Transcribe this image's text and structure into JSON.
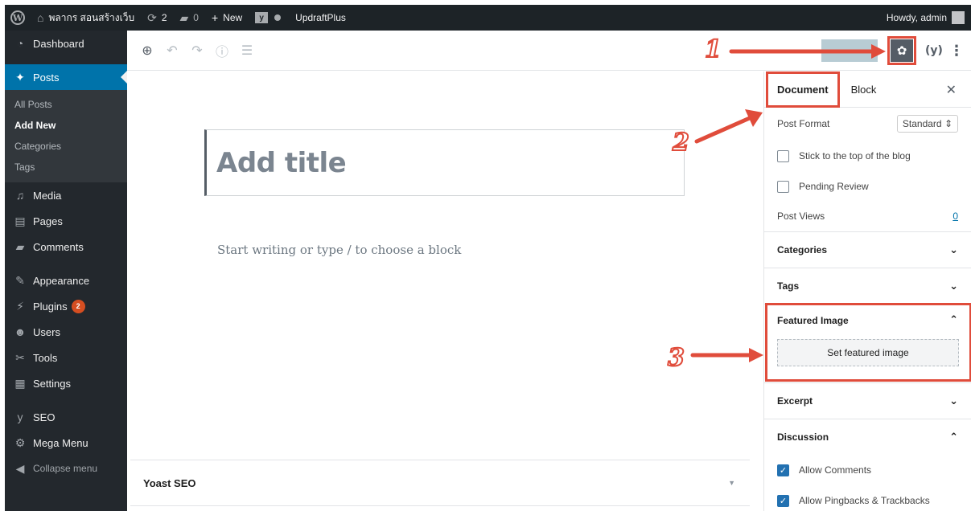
{
  "adminbar": {
    "site_name": "พลากร สอนสร้างเว็บ",
    "updates_count": "2",
    "comments_count": "0",
    "new_label": "New",
    "plugin_label": "UpdraftPlus",
    "greeting": "Howdy, admin"
  },
  "sidebar": {
    "items": [
      {
        "label": "Dashboard",
        "icon": "dashboard-icon"
      },
      {
        "label": "Posts",
        "icon": "pin-icon"
      },
      {
        "label": "Media",
        "icon": "media-icon"
      },
      {
        "label": "Pages",
        "icon": "pages-icon"
      },
      {
        "label": "Comments",
        "icon": "comment-icon"
      },
      {
        "label": "Appearance",
        "icon": "brush-icon"
      },
      {
        "label": "Plugins",
        "icon": "plugin-icon",
        "badge": "2"
      },
      {
        "label": "Users",
        "icon": "users-icon"
      },
      {
        "label": "Tools",
        "icon": "wrench-icon"
      },
      {
        "label": "Settings",
        "icon": "settings-icon"
      },
      {
        "label": "SEO",
        "icon": "yoast-icon"
      },
      {
        "label": "Mega Menu",
        "icon": "megamenu-icon"
      },
      {
        "label": "Collapse menu",
        "icon": "collapse-icon"
      }
    ],
    "posts_submenu": [
      "All Posts",
      "Add New",
      "Categories",
      "Tags"
    ]
  },
  "editor": {
    "title_placeholder": "Add title",
    "block_placeholder": "Start writing or type / to choose a block",
    "metabox_title": "Yoast SEO"
  },
  "settings": {
    "tabs": [
      "Document",
      "Block"
    ],
    "post_format_label": "Post Format",
    "post_format_value": "Standard",
    "stick_label": "Stick to the top of the blog",
    "pending_label": "Pending Review",
    "post_views_label": "Post Views",
    "post_views_value": "0",
    "sections": {
      "categories": "Categories",
      "tags": "Tags",
      "featured": "Featured Image",
      "set_featured": "Set featured image",
      "excerpt": "Excerpt",
      "discussion": "Discussion"
    },
    "allow_comments_label": "Allow Comments",
    "allow_pingbacks_label": "Allow Pingbacks & Trackbacks"
  },
  "annotations": [
    "1",
    "2",
    "3"
  ],
  "colors": {
    "accent_red": "#e04c3b",
    "wp_blue": "#0073aa",
    "menu_dark": "#23282d"
  }
}
